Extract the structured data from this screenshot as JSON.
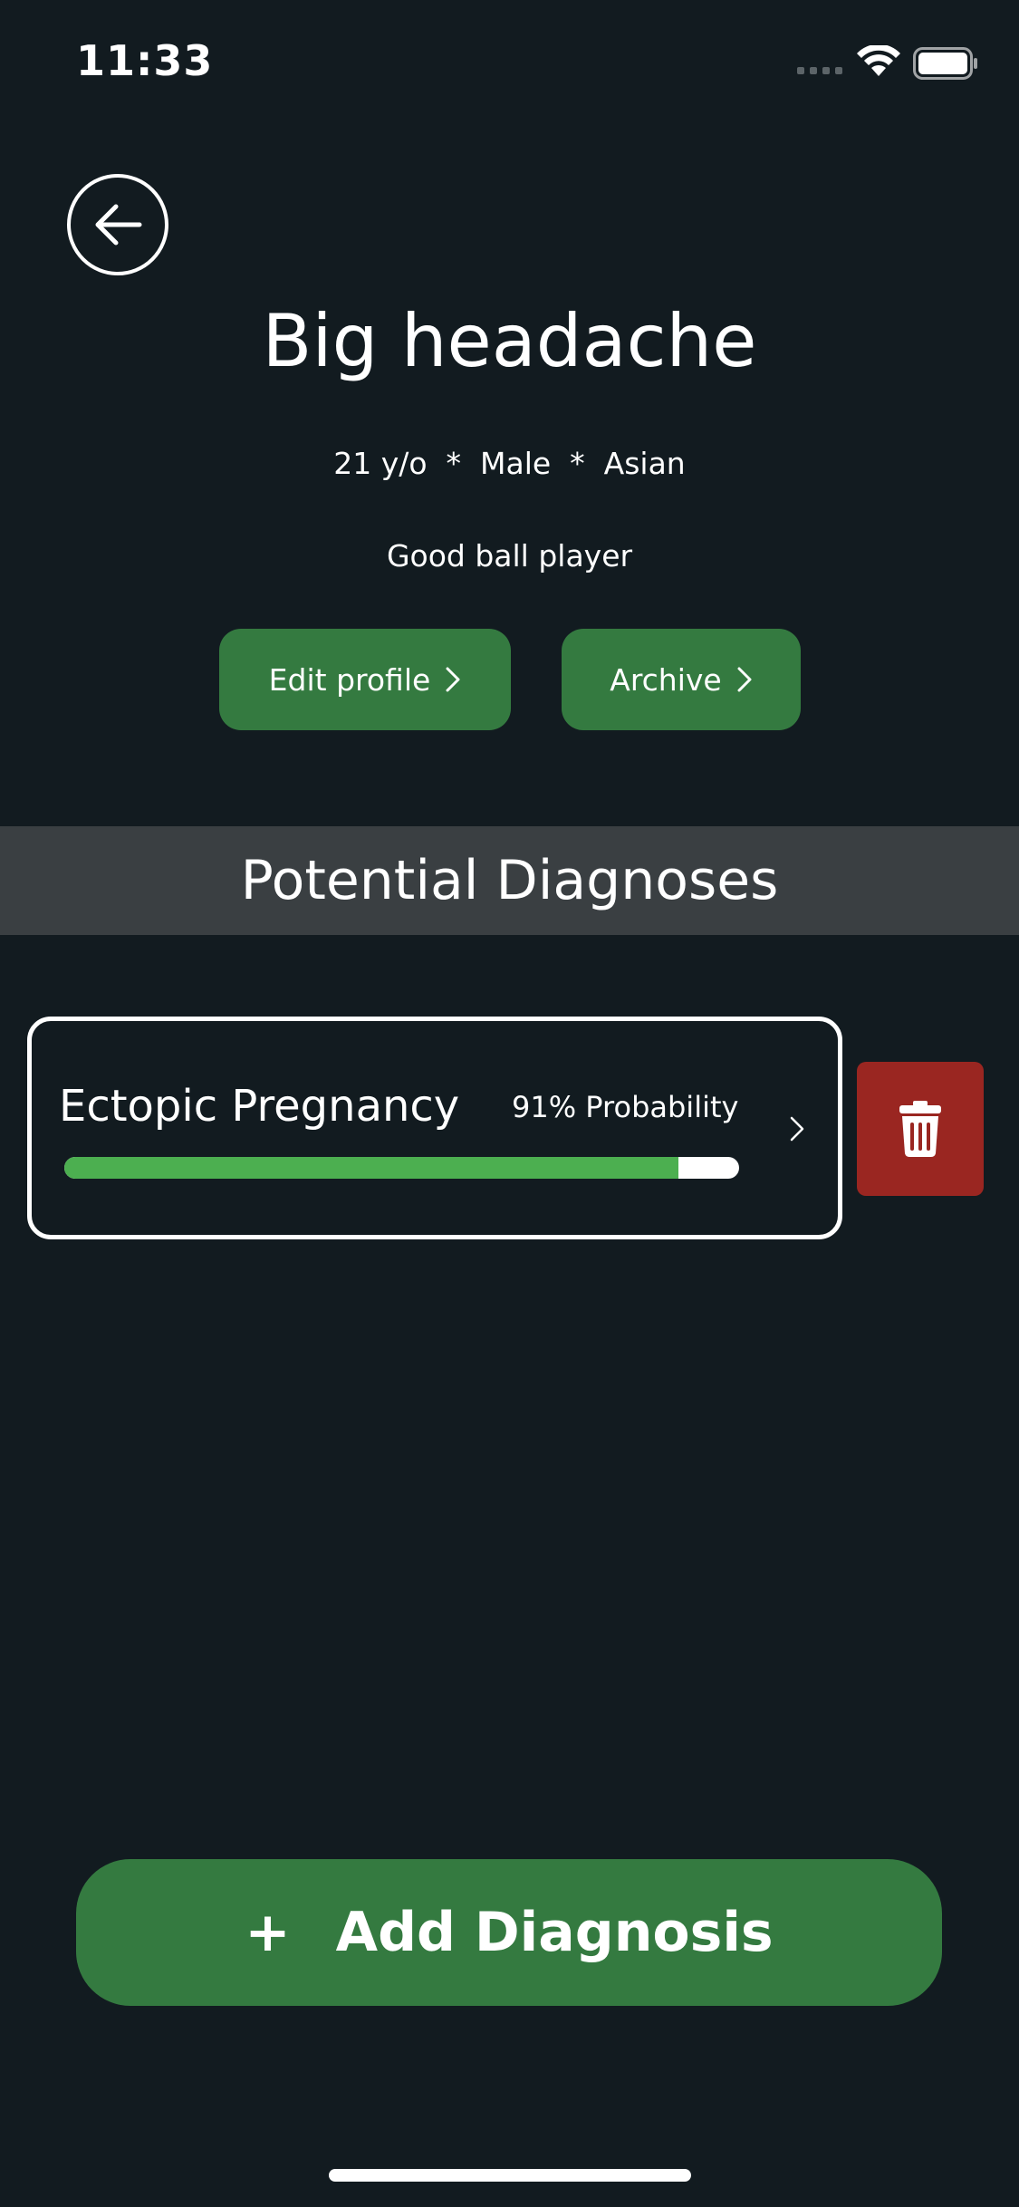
{
  "status_bar": {
    "time": "11:33"
  },
  "header": {
    "title": "Big headache",
    "meta": "21 y/o  *  Male  *  Asian",
    "bio": "Good ball player"
  },
  "actions": {
    "edit_profile": "Edit profile",
    "archive": "Archive"
  },
  "section": {
    "title": "Potential Diagnoses"
  },
  "diagnoses": [
    {
      "name": "Ectopic Pregnancy",
      "probability_label": "91% Probability",
      "probability": 0.91
    }
  ],
  "add_button": {
    "plus": "+",
    "label": "Add Diagnosis"
  },
  "colors": {
    "background": "#121b20",
    "accent_green": "#347a40",
    "progress_green": "#4caf50",
    "delete_red": "#9a2621",
    "band_gray": "#3a3f42"
  }
}
